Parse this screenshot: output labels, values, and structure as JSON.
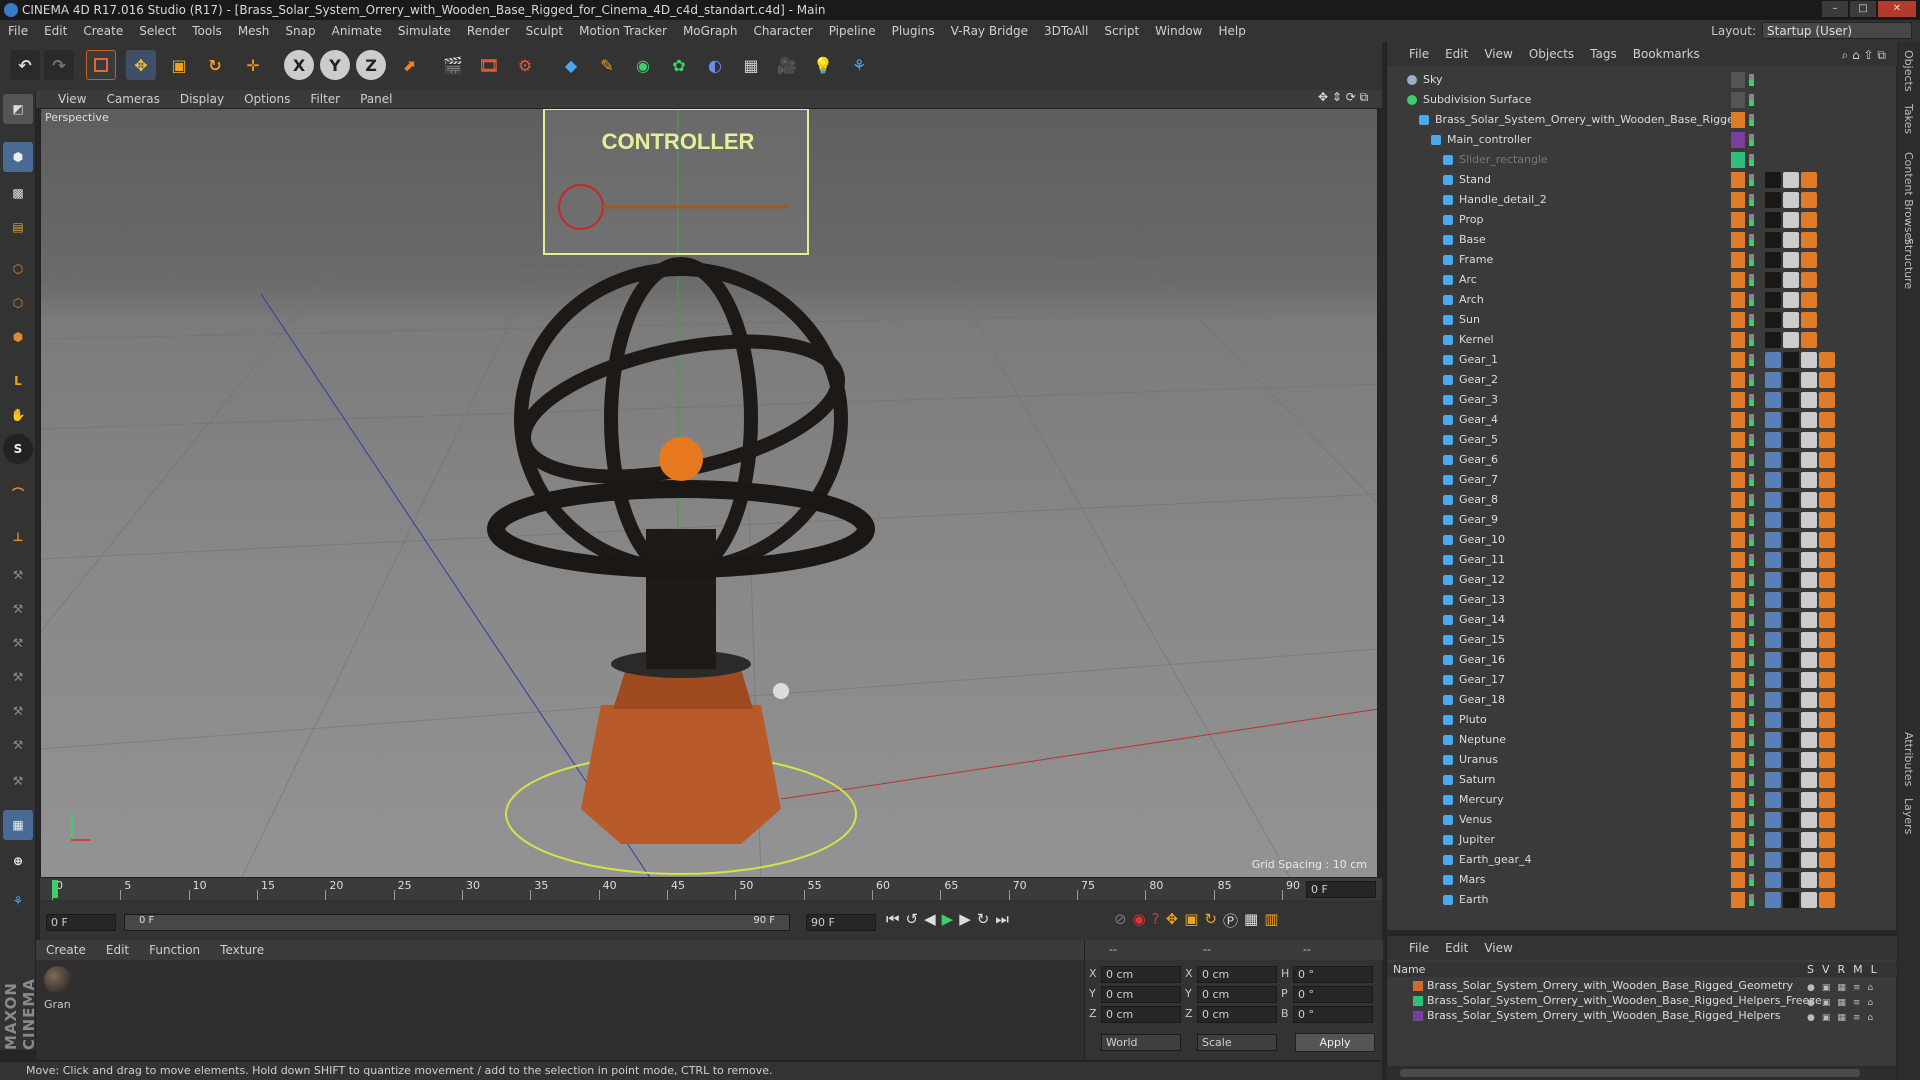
{
  "window": {
    "title": "CINEMA 4D R17.016 Studio (R17) - [Brass_Solar_System_Orrery_with_Wooden_Base_Rigged_for_Cinema_4D_c4d_standart.c4d] - Main"
  },
  "menubar": [
    "File",
    "Edit",
    "Create",
    "Select",
    "Tools",
    "Mesh",
    "Snap",
    "Animate",
    "Simulate",
    "Render",
    "Sculpt",
    "Motion Tracker",
    "MoGraph",
    "Character",
    "Pipeline",
    "Plugins",
    "V-Ray Bridge",
    "3DToAll",
    "Script",
    "Window",
    "Help"
  ],
  "layout": {
    "label": "Layout:",
    "value": "Startup (User)"
  },
  "toolbar": {
    "axes": [
      "X",
      "Y",
      "Z"
    ]
  },
  "left_tools": {
    "s_label": "S"
  },
  "viewport": {
    "menu": [
      "View",
      "Cameras",
      "Display",
      "Options",
      "Filter",
      "Panel"
    ],
    "label": "Perspective",
    "controller_label": "CONTROLLER",
    "grid_spacing": "Grid Spacing : 10 cm"
  },
  "timeline": {
    "ticks": [
      "0",
      "5",
      "10",
      "15",
      "20",
      "25",
      "30",
      "35",
      "40",
      "45",
      "50",
      "55",
      "60",
      "65",
      "70",
      "75",
      "80",
      "85",
      "90"
    ],
    "current_frame": "0 F",
    "start_field": "0 F",
    "range_start": "0 F",
    "range_end": "90 F",
    "end_field": "90 F"
  },
  "material": {
    "menu": [
      "Create",
      "Edit",
      "Function",
      "Texture"
    ],
    "item_label": "Gran"
  },
  "coordinates": {
    "headers": [
      "--",
      "--",
      "--"
    ],
    "rows": [
      {
        "a": "X",
        "av": "0 cm",
        "b": "X",
        "bv": "0 cm",
        "c": "H",
        "cv": "0 °"
      },
      {
        "a": "Y",
        "av": "0 cm",
        "b": "Y",
        "bv": "0 cm",
        "c": "P",
        "cv": "0 °"
      },
      {
        "a": "Z",
        "av": "0 cm",
        "b": "Z",
        "bv": "0 cm",
        "c": "B",
        "cv": "0 °"
      }
    ],
    "space": "World",
    "mode": "Scale",
    "apply": "Apply"
  },
  "status": "Move: Click and drag to move elements. Hold down SHIFT to quantize movement / add to the selection in point mode, CTRL to remove.",
  "objects": {
    "menu": [
      "File",
      "Edit",
      "View",
      "Objects",
      "Tags",
      "Bookmarks"
    ],
    "items": [
      {
        "name": "Sky",
        "indent": 0
      },
      {
        "name": "Subdivision Surface",
        "indent": 0
      },
      {
        "name": "Brass_Solar_System_Orrery_with_Wooden_Base_Rigged",
        "indent": 1
      },
      {
        "name": "Main_controller",
        "indent": 2
      },
      {
        "name": "Slider_rectangle",
        "indent": 3
      },
      {
        "name": "Stand",
        "indent": 3
      },
      {
        "name": "Handle_detail_2",
        "indent": 3
      },
      {
        "name": "Prop",
        "indent": 3
      },
      {
        "name": "Base",
        "indent": 3
      },
      {
        "name": "Frame",
        "indent": 3
      },
      {
        "name": "Arc",
        "indent": 3
      },
      {
        "name": "Arch",
        "indent": 3
      },
      {
        "name": "Sun",
        "indent": 3
      },
      {
        "name": "Kernel",
        "indent": 3
      },
      {
        "name": "Gear_1",
        "indent": 3
      },
      {
        "name": "Gear_2",
        "indent": 3
      },
      {
        "name": "Gear_3",
        "indent": 3
      },
      {
        "name": "Gear_4",
        "indent": 3
      },
      {
        "name": "Gear_5",
        "indent": 3
      },
      {
        "name": "Gear_6",
        "indent": 3
      },
      {
        "name": "Gear_7",
        "indent": 3
      },
      {
        "name": "Gear_8",
        "indent": 3
      },
      {
        "name": "Gear_9",
        "indent": 3
      },
      {
        "name": "Gear_10",
        "indent": 3
      },
      {
        "name": "Gear_11",
        "indent": 3
      },
      {
        "name": "Gear_12",
        "indent": 3
      },
      {
        "name": "Gear_13",
        "indent": 3
      },
      {
        "name": "Gear_14",
        "indent": 3
      },
      {
        "name": "Gear_15",
        "indent": 3
      },
      {
        "name": "Gear_16",
        "indent": 3
      },
      {
        "name": "Gear_17",
        "indent": 3
      },
      {
        "name": "Gear_18",
        "indent": 3
      },
      {
        "name": "Pluto",
        "indent": 3
      },
      {
        "name": "Neptune",
        "indent": 3
      },
      {
        "name": "Uranus",
        "indent": 3
      },
      {
        "name": "Saturn",
        "indent": 3
      },
      {
        "name": "Mercury",
        "indent": 3
      },
      {
        "name": "Venus",
        "indent": 3
      },
      {
        "name": "Jupiter",
        "indent": 3
      },
      {
        "name": "Earth_gear_4",
        "indent": 3
      },
      {
        "name": "Mars",
        "indent": 3
      },
      {
        "name": "Earth",
        "indent": 3
      }
    ]
  },
  "layers": {
    "menu": [
      "File",
      "Edit",
      "View"
    ],
    "header_name": "Name",
    "header_cols": [
      "S",
      "V",
      "R",
      "M",
      "L"
    ],
    "items": [
      {
        "name": "Brass_Solar_System_Orrery_with_Wooden_Base_Rigged_Geometry",
        "color": "#d2692f"
      },
      {
        "name": "Brass_Solar_System_Orrery_with_Wooden_Base_Rigged_Helpers_Freeze",
        "color": "#2fbf7a"
      },
      {
        "name": "Brass_Solar_System_Orrery_with_Wooden_Base_Rigged_Helpers",
        "color": "#7a3f9a"
      }
    ]
  },
  "side_tabs": [
    "Objects",
    "Takes",
    "Content Browser",
    "Structure",
    "Attributes",
    "Layers"
  ],
  "brand": "MAXON CINEMA 4D",
  "colors": {
    "accent_blue": "#3a78c9",
    "orange_tag": "#e07b2a",
    "green": "#4cd26b",
    "controller": "#e4ee9a"
  }
}
